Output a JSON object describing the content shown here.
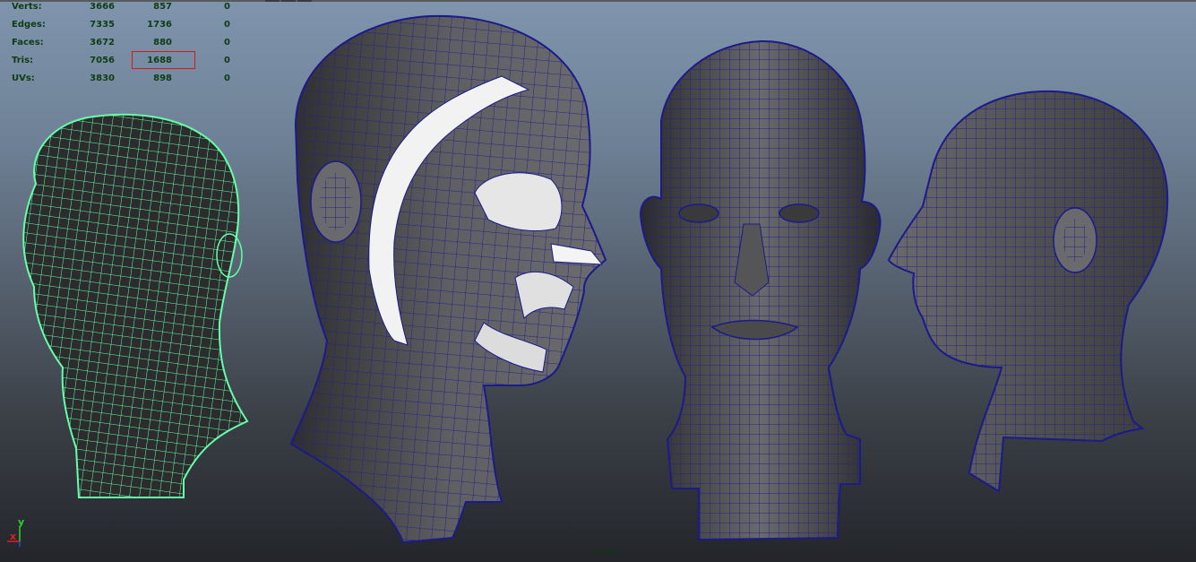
{
  "hud": {
    "rows": [
      {
        "label": "Verts:",
        "a": "3666",
        "b": "857",
        "c": "0"
      },
      {
        "label": "Edges:",
        "a": "7335",
        "b": "1736",
        "c": "0"
      },
      {
        "label": "Faces:",
        "a": "3672",
        "b": "880",
        "c": "0"
      },
      {
        "label": "Tris:",
        "a": "7056",
        "b": "1688",
        "c": "0"
      },
      {
        "label": "UVs:",
        "a": "3830",
        "b": "898",
        "c": "0"
      }
    ],
    "highlight_color": "#d01a1a"
  },
  "viewport": {
    "camera_label": "persp"
  },
  "axis": {
    "y": "y",
    "x": "x"
  },
  "colors": {
    "wire_selected": "#66ffa8",
    "wire_blue": "#1a1a8a",
    "mesh_gray": "#5e5e62",
    "highlight_faces": "#ffffff"
  }
}
